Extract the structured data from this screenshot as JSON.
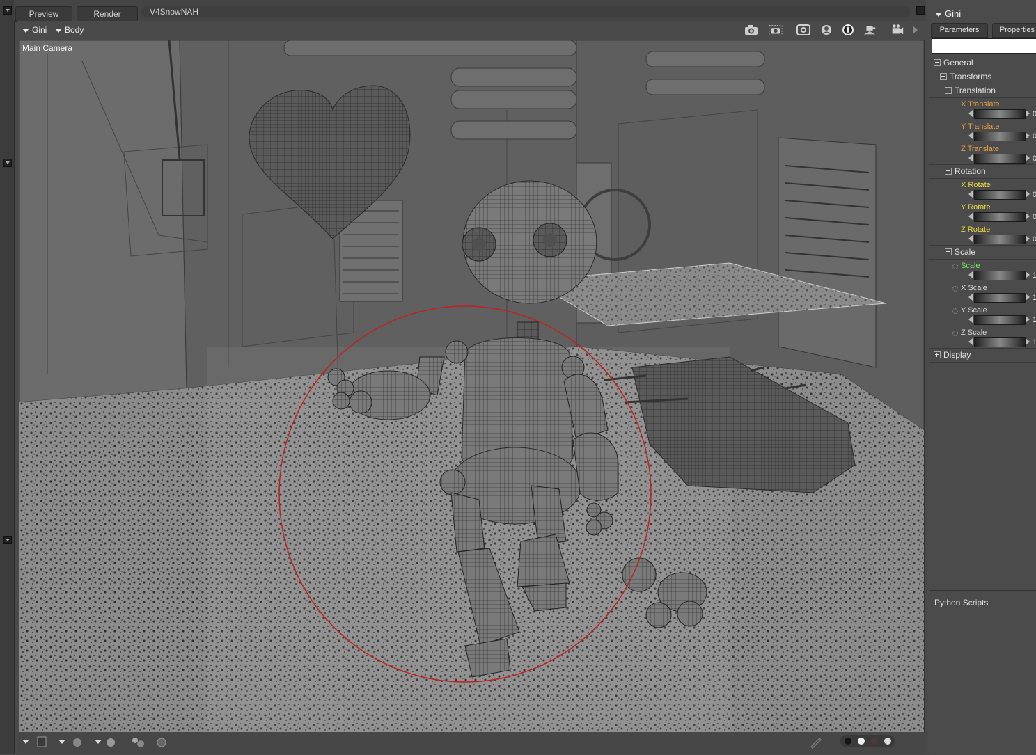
{
  "tabs": {
    "preview": "Preview",
    "render": "Render",
    "document": "V4SnowNAH"
  },
  "viewport": {
    "figure_menu": "Gini",
    "actor_menu": "Body",
    "camera_label": "Main Camera"
  },
  "right_panel": {
    "title": "Gini",
    "tab_parameters": "Parameters",
    "tab_properties": "Properties",
    "general": "General",
    "transforms": "Transforms",
    "translation": "Translation",
    "x_translate": "X Translate",
    "y_translate": "Y Translate",
    "z_translate": "Z Translate",
    "rotation": "Rotation",
    "x_rotate": "X Rotate",
    "y_rotate": "Y Rotate",
    "z_rotate": "Z Rotate",
    "scale_group": "Scale",
    "scale": "Scale",
    "x_scale": "X Scale",
    "y_scale": "Y Scale",
    "z_scale": "Z Scale",
    "display": "Display",
    "translate_value": "0",
    "rotate_value": "0",
    "scale_value": "1",
    "python_scripts": "Python Scripts"
  },
  "colors": {
    "translate_label": "#e8a040",
    "rotate_label": "#e8d840",
    "scale_label": "#78e860",
    "xyz_scale_label": "#d8d8d8",
    "selection_circle": "#c02020"
  }
}
